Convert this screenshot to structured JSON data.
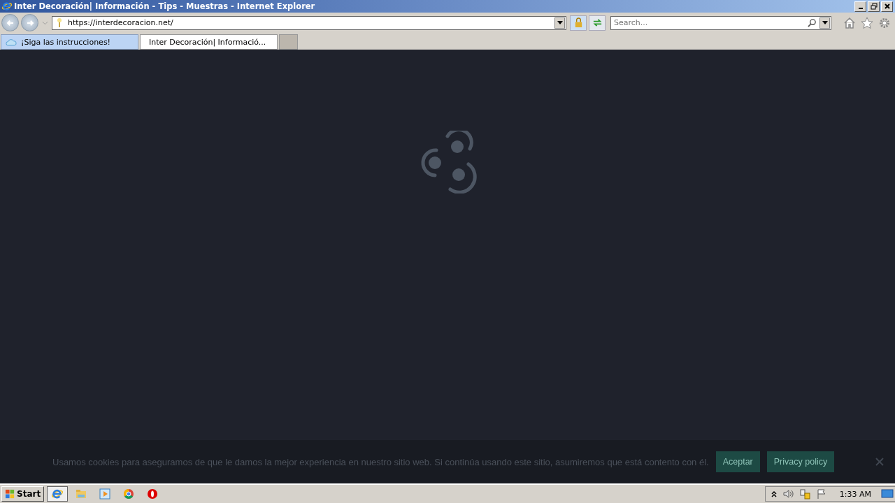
{
  "window": {
    "title": "Inter Decoración| Información - Tips - Muestras - Internet Explorer"
  },
  "address_bar": {
    "value": "https://interdecoracion.net/"
  },
  "search": {
    "placeholder": "Search..."
  },
  "tabs": [
    {
      "label": "¡Siga las instrucciones!",
      "selected": false
    },
    {
      "label": "Inter Decoración| Informació...",
      "selected": true
    }
  ],
  "cookie_bar": {
    "text": "Usamos cookies para aseguramos de que le damos la mejor experiencia en nuestro sitio web. Si continúa usando este sitio, asumiremos que está contento con él.",
    "buttons": [
      "Aceptar",
      "Privacy policy"
    ]
  },
  "taskbar": {
    "start": "Start",
    "clock": "1:33 AM"
  }
}
